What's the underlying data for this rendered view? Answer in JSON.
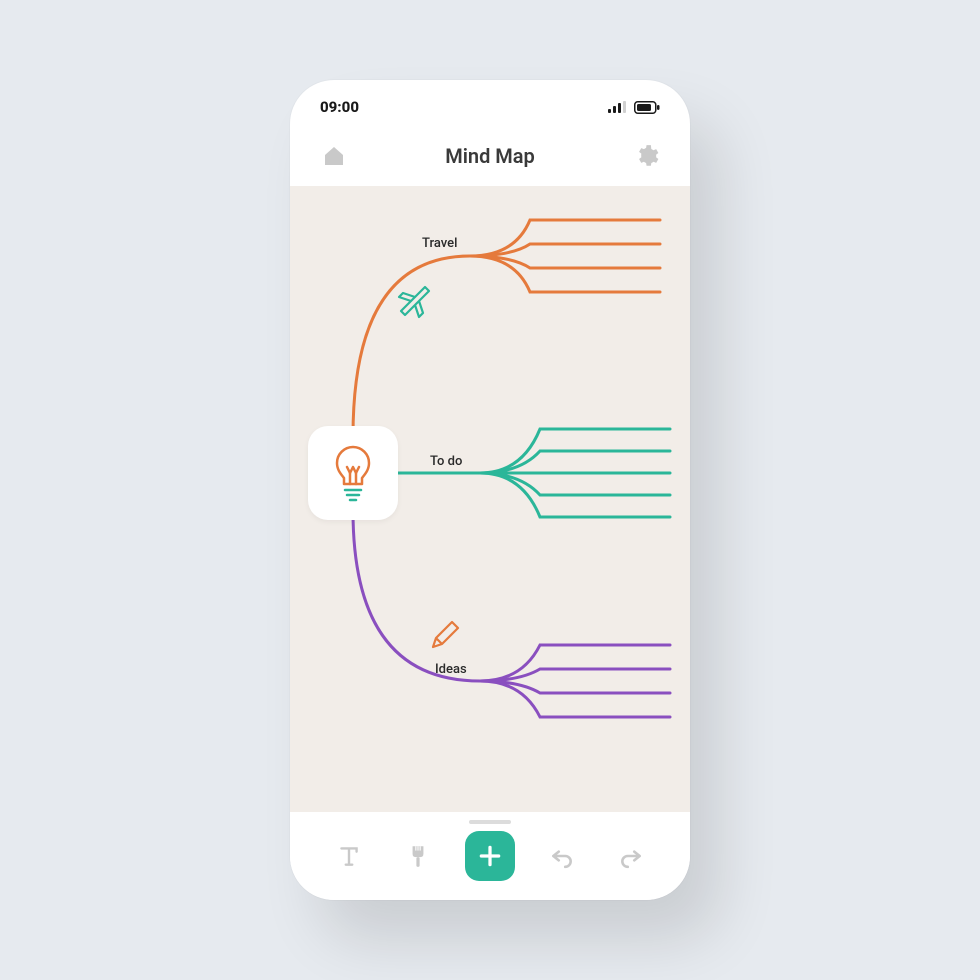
{
  "status": {
    "time": "09:00"
  },
  "header": {
    "title": "Mind Map",
    "home_icon": "home-icon",
    "settings_icon": "gear-icon"
  },
  "mindmap": {
    "root_icon": "lightbulb-icon",
    "branches": [
      {
        "label": "Travel",
        "icon": "plane-icon",
        "color": "#e57a3c",
        "children": 4
      },
      {
        "label": "To do",
        "icon": null,
        "color": "#2bb699",
        "children": 5
      },
      {
        "label": "Ideas",
        "icon": "pencil-icon",
        "color": "#8a4fbf",
        "children": 4
      }
    ]
  },
  "toolbar": {
    "text_tool": "text-tool",
    "brush_tool": "brush-tool",
    "add_tool": "add-tool",
    "undo_tool": "undo-tool",
    "redo_tool": "redo-tool"
  },
  "colors": {
    "orange": "#e57a3c",
    "teal": "#2bb699",
    "purple": "#8a4fbf",
    "canvas_bg": "#f2ede8",
    "icon_muted": "#c9c9c9"
  }
}
